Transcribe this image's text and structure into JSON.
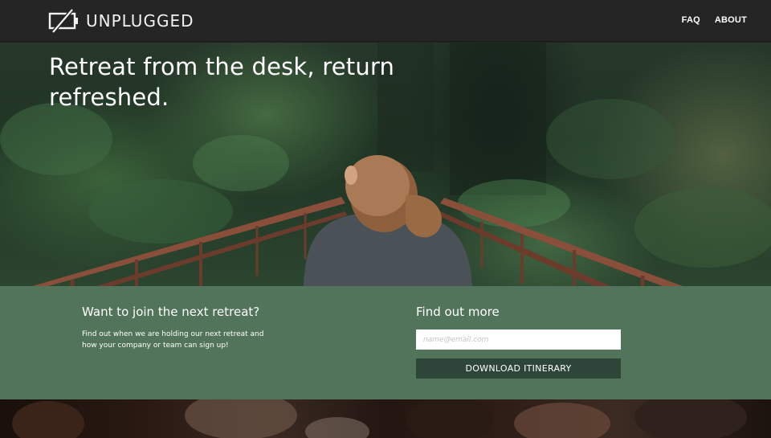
{
  "brand": {
    "name": "UNPLUGGED",
    "icon": "unplugged-battery-icon"
  },
  "nav": {
    "links": [
      {
        "label": "FAQ"
      },
      {
        "label": "ABOUT"
      }
    ]
  },
  "hero": {
    "title": "Retreat from the desk, return refreshed."
  },
  "signup": {
    "join_heading": "Want to join the next retreat?",
    "join_text": "Find out when we are holding our next retreat and how your company or team can sign up!",
    "find_heading": "Find out more",
    "email_placeholder": "name@email.com",
    "email_value": "",
    "download_label": "DOWNLOAD ITINERARY"
  },
  "colors": {
    "nav_bg": "#252525",
    "signup_bg": "#52745a",
    "button_bg": "#2e463a",
    "text": "#ffffff"
  }
}
